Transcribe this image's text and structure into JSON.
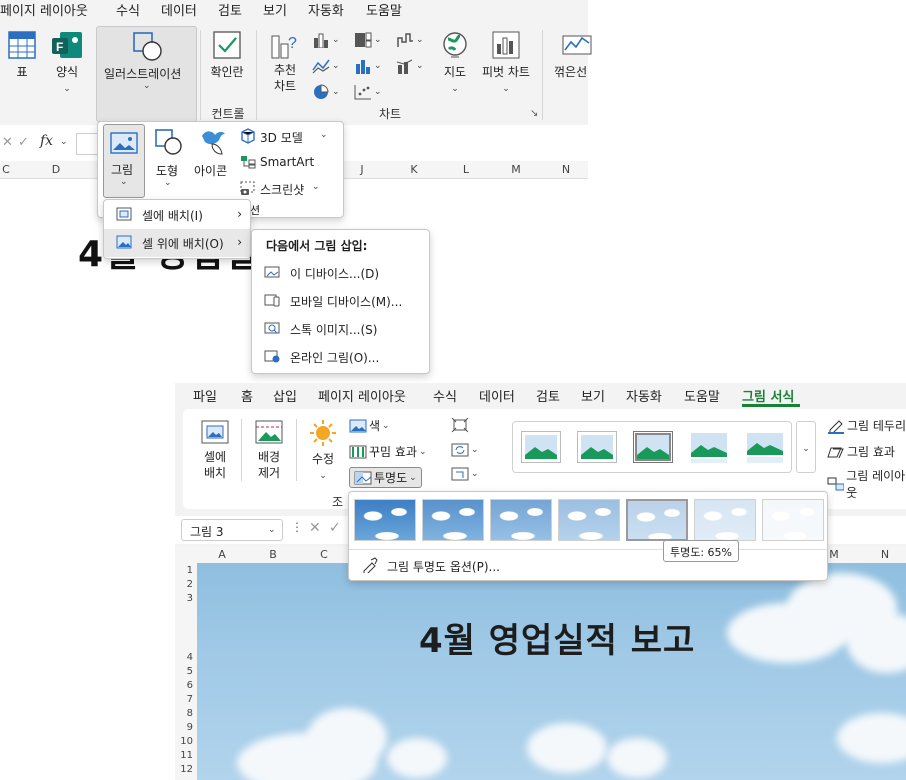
{
  "top": {
    "menu_tabs": [
      "페이지 레이아웃",
      "수식",
      "데이터",
      "검토",
      "보기",
      "자동화",
      "도움말"
    ],
    "ribbon": {
      "table": "표",
      "forms": "양식",
      "illustrations": "일러스트레이션",
      "checkbox": "확인란",
      "recommended_charts_line1": "추천",
      "recommended_charts_line2": "차트",
      "maps": "지도",
      "pivot_chart": "피벗 차트",
      "sparkline_line": "꺾은선",
      "group_controls": "컨트롤",
      "group_charts": "차트"
    },
    "formula_fx": "fx",
    "columns": [
      "C",
      "D",
      "J",
      "K",
      "L",
      "M",
      "N"
    ],
    "partial_title": "4월 영업실",
    "illustrations_popup": {
      "picture": "그림",
      "shapes": "도형",
      "icons": "아이콘",
      "model3d": "3D 모델",
      "smartart": "SmartArt",
      "screenshot": "스크린샷",
      "hidden_tail": "션"
    },
    "picture_menu": {
      "place_in_cell": "셀에 배치(I)",
      "place_over_cells": "셀 위에 배치(O)"
    },
    "insert_from": {
      "heading": "다음에서 그림 삽입:",
      "this_device": "이 디바이스...(D)",
      "mobile_device": "모바일 디바이스(M)...",
      "stock_images": "스톡 이미지...(S)",
      "online_pictures": "온라인 그림(O)..."
    }
  },
  "bottom": {
    "menu_tabs": [
      "파일",
      "홈",
      "삽입",
      "페이지 레이아웃",
      "수식",
      "데이터",
      "검토",
      "보기",
      "자동화",
      "도움말",
      "그림 서식"
    ],
    "active_tab": "그림 서식",
    "ribbon": {
      "place_in_cell_line1": "셀에",
      "place_in_cell_line2": "배치",
      "remove_bg_line1": "배경",
      "remove_bg_line2": "제거",
      "corrections": "수정",
      "color": "색",
      "artistic_effects": "꾸밈 효과",
      "transparency": "투명도",
      "group_adjust_partial": "조",
      "picture_border": "그림 테두리",
      "picture_effects": "그림 효과",
      "picture_layout": "그림 레이아웃"
    },
    "name_box": "그림 3",
    "columns": [
      "A",
      "B",
      "C",
      "M",
      "N"
    ],
    "rows": [
      "1",
      "2",
      "3",
      "4",
      "5",
      "6",
      "7",
      "8",
      "9",
      "10",
      "11",
      "12"
    ],
    "report_title": "4월 영업실적 보고",
    "transparency_gallery": {
      "levels_percent": [
        0,
        15,
        30,
        50,
        65,
        80,
        95
      ],
      "selected_percent": 65,
      "tooltip": "투명도: 65%",
      "options": "그림 투명도 옵션(P)..."
    }
  },
  "colors": {
    "accent_green": "#1a7f37",
    "ribbon_bg": "#f3f3f3",
    "icon_blue": "#2b6fc2"
  }
}
